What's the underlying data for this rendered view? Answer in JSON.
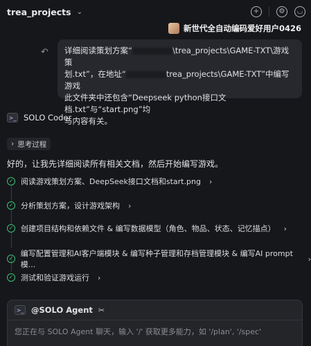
{
  "header": {
    "project_title": "trea_projects",
    "icons": [
      "chevron-down-icon",
      "new-chat-icon",
      "settings-icon",
      "account-icon"
    ]
  },
  "user": {
    "name": "新世代全自动编码爱好用户0426"
  },
  "user_message": {
    "line1_pre": "详细阅读策划方案“",
    "line1_post": "\\trea_projects\\GAME-TXT\\游戏策",
    "line2_pre": "划.txt”，在地址“",
    "line2_post": "trea_projects\\GAME-TXT”中编写游戏",
    "line3": "此文件夹中还包含“Deepseek python接口文档.txt”与“start.png”均",
    "line4": "与内容有关。"
  },
  "agent": {
    "name": "SOLO Coder"
  },
  "thinking": {
    "label": "思考过程"
  },
  "reply_intro": "好的，让我先详细阅读所有相关文档，然后开始编写游戏。",
  "steps": [
    {
      "label": "阅读游戏策划方案、DeepSeek接口文档和start.png"
    },
    {
      "label": "分析策划方案，设计游戏架构"
    },
    {
      "label": "创建项目结构和依赖文件 & 编写数据模型（角色、物品、状态、记忆描点）"
    },
    {
      "label": "编写配置管理和AI客户端模块 & 编写种子管理和存档管理模块 & 编写AI prompt模..."
    },
    {
      "label": "测试和验证游戏运行"
    }
  ],
  "input": {
    "title": "@SOLO Agent",
    "placeholder": "您正在与 SOLO Agent 聊天，输入 '/' 获取更多能力，如 '/plan', '/spec'"
  },
  "colors": {
    "background": "#16171b",
    "bubble": "#26282d",
    "success": "#3fbf78",
    "agent_accent": "#c9b6ff"
  }
}
